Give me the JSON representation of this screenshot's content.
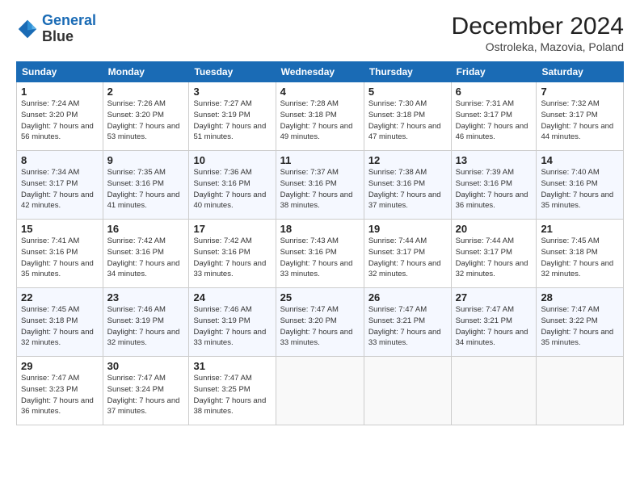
{
  "header": {
    "logo_line1": "General",
    "logo_line2": "Blue",
    "month": "December 2024",
    "location": "Ostroleka, Mazovia, Poland"
  },
  "weekdays": [
    "Sunday",
    "Monday",
    "Tuesday",
    "Wednesday",
    "Thursday",
    "Friday",
    "Saturday"
  ],
  "weeks": [
    [
      {
        "day": "1",
        "rise": "Sunrise: 7:24 AM",
        "set": "Sunset: 3:20 PM",
        "daylight": "Daylight: 7 hours and 56 minutes."
      },
      {
        "day": "2",
        "rise": "Sunrise: 7:26 AM",
        "set": "Sunset: 3:20 PM",
        "daylight": "Daylight: 7 hours and 53 minutes."
      },
      {
        "day": "3",
        "rise": "Sunrise: 7:27 AM",
        "set": "Sunset: 3:19 PM",
        "daylight": "Daylight: 7 hours and 51 minutes."
      },
      {
        "day": "4",
        "rise": "Sunrise: 7:28 AM",
        "set": "Sunset: 3:18 PM",
        "daylight": "Daylight: 7 hours and 49 minutes."
      },
      {
        "day": "5",
        "rise": "Sunrise: 7:30 AM",
        "set": "Sunset: 3:18 PM",
        "daylight": "Daylight: 7 hours and 47 minutes."
      },
      {
        "day": "6",
        "rise": "Sunrise: 7:31 AM",
        "set": "Sunset: 3:17 PM",
        "daylight": "Daylight: 7 hours and 46 minutes."
      },
      {
        "day": "7",
        "rise": "Sunrise: 7:32 AM",
        "set": "Sunset: 3:17 PM",
        "daylight": "Daylight: 7 hours and 44 minutes."
      }
    ],
    [
      {
        "day": "8",
        "rise": "Sunrise: 7:34 AM",
        "set": "Sunset: 3:17 PM",
        "daylight": "Daylight: 7 hours and 42 minutes."
      },
      {
        "day": "9",
        "rise": "Sunrise: 7:35 AM",
        "set": "Sunset: 3:16 PM",
        "daylight": "Daylight: 7 hours and 41 minutes."
      },
      {
        "day": "10",
        "rise": "Sunrise: 7:36 AM",
        "set": "Sunset: 3:16 PM",
        "daylight": "Daylight: 7 hours and 40 minutes."
      },
      {
        "day": "11",
        "rise": "Sunrise: 7:37 AM",
        "set": "Sunset: 3:16 PM",
        "daylight": "Daylight: 7 hours and 38 minutes."
      },
      {
        "day": "12",
        "rise": "Sunrise: 7:38 AM",
        "set": "Sunset: 3:16 PM",
        "daylight": "Daylight: 7 hours and 37 minutes."
      },
      {
        "day": "13",
        "rise": "Sunrise: 7:39 AM",
        "set": "Sunset: 3:16 PM",
        "daylight": "Daylight: 7 hours and 36 minutes."
      },
      {
        "day": "14",
        "rise": "Sunrise: 7:40 AM",
        "set": "Sunset: 3:16 PM",
        "daylight": "Daylight: 7 hours and 35 minutes."
      }
    ],
    [
      {
        "day": "15",
        "rise": "Sunrise: 7:41 AM",
        "set": "Sunset: 3:16 PM",
        "daylight": "Daylight: 7 hours and 35 minutes."
      },
      {
        "day": "16",
        "rise": "Sunrise: 7:42 AM",
        "set": "Sunset: 3:16 PM",
        "daylight": "Daylight: 7 hours and 34 minutes."
      },
      {
        "day": "17",
        "rise": "Sunrise: 7:42 AM",
        "set": "Sunset: 3:16 PM",
        "daylight": "Daylight: 7 hours and 33 minutes."
      },
      {
        "day": "18",
        "rise": "Sunrise: 7:43 AM",
        "set": "Sunset: 3:16 PM",
        "daylight": "Daylight: 7 hours and 33 minutes."
      },
      {
        "day": "19",
        "rise": "Sunrise: 7:44 AM",
        "set": "Sunset: 3:17 PM",
        "daylight": "Daylight: 7 hours and 32 minutes."
      },
      {
        "day": "20",
        "rise": "Sunrise: 7:44 AM",
        "set": "Sunset: 3:17 PM",
        "daylight": "Daylight: 7 hours and 32 minutes."
      },
      {
        "day": "21",
        "rise": "Sunrise: 7:45 AM",
        "set": "Sunset: 3:18 PM",
        "daylight": "Daylight: 7 hours and 32 minutes."
      }
    ],
    [
      {
        "day": "22",
        "rise": "Sunrise: 7:45 AM",
        "set": "Sunset: 3:18 PM",
        "daylight": "Daylight: 7 hours and 32 minutes."
      },
      {
        "day": "23",
        "rise": "Sunrise: 7:46 AM",
        "set": "Sunset: 3:19 PM",
        "daylight": "Daylight: 7 hours and 32 minutes."
      },
      {
        "day": "24",
        "rise": "Sunrise: 7:46 AM",
        "set": "Sunset: 3:19 PM",
        "daylight": "Daylight: 7 hours and 33 minutes."
      },
      {
        "day": "25",
        "rise": "Sunrise: 7:47 AM",
        "set": "Sunset: 3:20 PM",
        "daylight": "Daylight: 7 hours and 33 minutes."
      },
      {
        "day": "26",
        "rise": "Sunrise: 7:47 AM",
        "set": "Sunset: 3:21 PM",
        "daylight": "Daylight: 7 hours and 33 minutes."
      },
      {
        "day": "27",
        "rise": "Sunrise: 7:47 AM",
        "set": "Sunset: 3:21 PM",
        "daylight": "Daylight: 7 hours and 34 minutes."
      },
      {
        "day": "28",
        "rise": "Sunrise: 7:47 AM",
        "set": "Sunset: 3:22 PM",
        "daylight": "Daylight: 7 hours and 35 minutes."
      }
    ],
    [
      {
        "day": "29",
        "rise": "Sunrise: 7:47 AM",
        "set": "Sunset: 3:23 PM",
        "daylight": "Daylight: 7 hours and 36 minutes."
      },
      {
        "day": "30",
        "rise": "Sunrise: 7:47 AM",
        "set": "Sunset: 3:24 PM",
        "daylight": "Daylight: 7 hours and 37 minutes."
      },
      {
        "day": "31",
        "rise": "Sunrise: 7:47 AM",
        "set": "Sunset: 3:25 PM",
        "daylight": "Daylight: 7 hours and 38 minutes."
      },
      null,
      null,
      null,
      null
    ]
  ]
}
